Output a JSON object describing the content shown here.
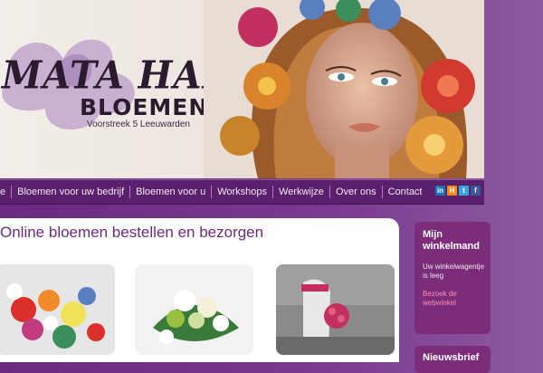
{
  "brand": {
    "name": "MATA HARI",
    "subtitle": "BLOEMEN",
    "address": "Voorstreek 5 Leeuwarden"
  },
  "nav": {
    "items": [
      "e",
      "Bloemen voor uw bedrijf",
      "Bloemen voor u",
      "Workshops",
      "Werkwijze",
      "Over ons",
      "Contact"
    ]
  },
  "social": {
    "linkedin": "in",
    "hyves": "H",
    "twitter": "t",
    "facebook": "f"
  },
  "main": {
    "title": "Online bloemen bestellen en bezorgen"
  },
  "cart": {
    "title_line1": "Mijn",
    "title_line2": "winkelmand",
    "empty_text": "Uw winkelwagentje is leeg",
    "link_text": "Bezoek de webwinkel"
  },
  "newsletter": {
    "title": "Nieuwsbrief"
  },
  "colors": {
    "brand_purple": "#5a1f6d",
    "title_purple": "#6a2d7d",
    "sidebar_purple": "#7b2d7a",
    "link_pink": "#ff8fb5"
  }
}
